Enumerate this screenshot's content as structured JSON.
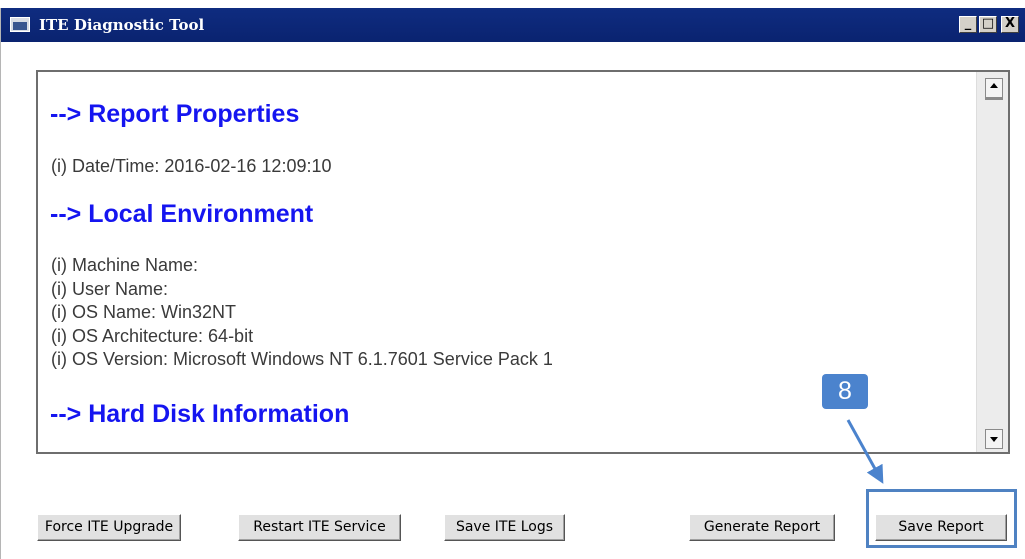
{
  "window": {
    "title": "ITE Diagnostic Tool",
    "controls": {
      "minimize": "_",
      "maximize": "□",
      "close": "X"
    }
  },
  "report": {
    "headings": {
      "report_properties": "--> Report Properties",
      "local_environment": "--> Local Environment",
      "hard_disk": "--> Hard Disk Information"
    },
    "datetime": "(i) Date/Time: 2016-02-16 12:09:10",
    "environment_lines": [
      "(i) Machine Name:",
      "(i) User Name:",
      "(i) OS Name: Win32NT",
      "(i) OS Architecture: 64-bit",
      "(i) OS Version: Microsoft Windows NT 6.1.7601 Service Pack 1"
    ]
  },
  "buttons": {
    "force_upgrade": "Force ITE Upgrade",
    "restart_service": "Restart ITE Service",
    "save_logs": "Save ITE Logs",
    "generate_report": "Generate Report",
    "save_report": "Save Report"
  },
  "annotation": {
    "step_number": "8",
    "color": "#4b83cd"
  },
  "colors": {
    "titlebar": "#0a2370",
    "heading": "#1515f0"
  }
}
